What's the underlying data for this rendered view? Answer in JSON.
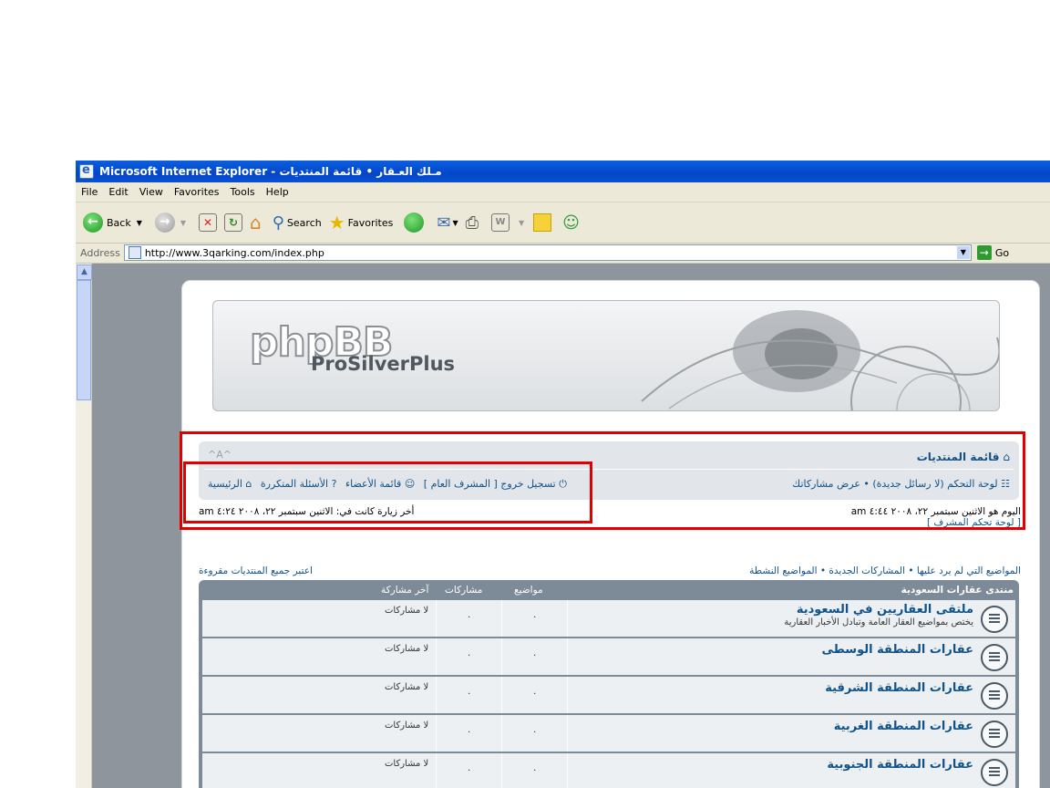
{
  "window": {
    "title": "مـلك العـقار • قائمة المنتديات - Microsoft Internet Explorer"
  },
  "menu": [
    "File",
    "Edit",
    "View",
    "Favorites",
    "Tools",
    "Help"
  ],
  "toolbar": {
    "back": "Back",
    "search": "Search",
    "favorites": "Favorites"
  },
  "address": {
    "label": "Address",
    "url": "http://www.3qarking.com/index.php",
    "go": "Go"
  },
  "logo": {
    "php": "phpBB",
    "pro": "ProSilverPlus"
  },
  "nav": {
    "forum_index": "قائمة المنتديات",
    "font_controls": "^A^",
    "ucp": "لوحة التحكم",
    "no_new_messages": "(لا رسائل جديدة)",
    "view_posts": "عرض مشاركاتك",
    "home": "الرئيسية",
    "faq": "الأسئلة المتكررة",
    "members": "قائمة الأعضاء",
    "logout": "تسجيل خروج [ المشرف العام ]",
    "today": "اليوم هو الاثنين سبتمبر ٢٢، ٢٠٠٨ ٤:٤٤ am",
    "acp": "[ لوحة تحكم المشرف ]",
    "last_visit": "أخر زيارة كانت في: الاثنين سبتمبر ٢٢، ٢٠٠٨ ٤:٢٤ am"
  },
  "links": {
    "unanswered": "المواضيع التي لم يرد عليها",
    "new_posts": "المشاركات الجديدة",
    "active": "المواضيع النشطة",
    "mark_read": "اعتبر جميع المنتديات مقروءة"
  },
  "forum": {
    "category": "منتدى عقارات السعودية",
    "col_topics": "مواضيع",
    "col_posts": "مشاركات",
    "col_last": "آخر مشاركة",
    "rows": [
      {
        "title": "ملتقى العقاريين في السعودية",
        "desc": "يختص بمواضيع العقار العامة وتبادل الأخبار العقارية",
        "topics": "٠",
        "posts": "٠",
        "last": "لا مشاركات"
      },
      {
        "title": "عقارات المنطقة الوسطى",
        "desc": "",
        "topics": "٠",
        "posts": "٠",
        "last": "لا مشاركات"
      },
      {
        "title": "عقارات المنطقة الشرقية",
        "desc": "",
        "topics": "٠",
        "posts": "٠",
        "last": "لا مشاركات"
      },
      {
        "title": "عقارات المنطقة الغربية",
        "desc": "",
        "topics": "٠",
        "posts": "٠",
        "last": "لا مشاركات"
      },
      {
        "title": "عقارات المنطقة الجنوبية",
        "desc": "",
        "topics": "٠",
        "posts": "٠",
        "last": "لا مشاركات"
      }
    ]
  }
}
